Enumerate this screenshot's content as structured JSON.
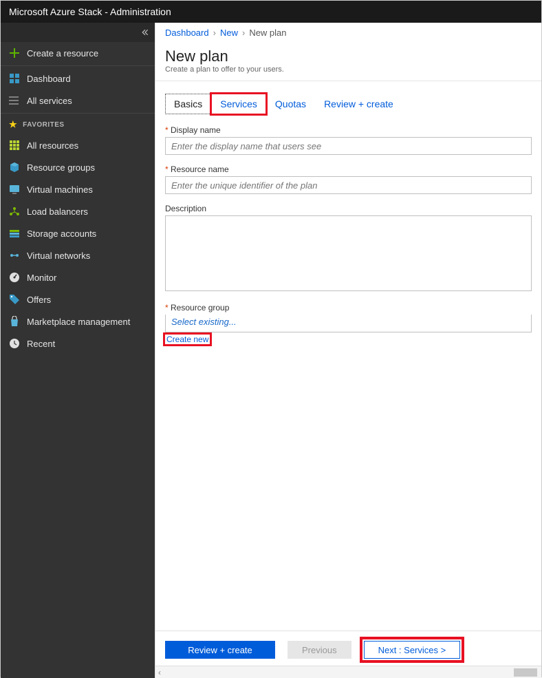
{
  "topbar": {
    "title": "Microsoft Azure Stack - Administration"
  },
  "sidebar": {
    "create": "Create a resource",
    "dashboard": "Dashboard",
    "all_services": "All services",
    "favorites_label": "FAVORITES",
    "items": [
      {
        "label": "All resources"
      },
      {
        "label": "Resource groups"
      },
      {
        "label": "Virtual machines"
      },
      {
        "label": "Load balancers"
      },
      {
        "label": "Storage accounts"
      },
      {
        "label": "Virtual networks"
      },
      {
        "label": "Monitor"
      },
      {
        "label": "Offers"
      },
      {
        "label": "Marketplace management"
      },
      {
        "label": "Recent"
      }
    ]
  },
  "breadcrumb": {
    "items": [
      "Dashboard",
      "New"
    ],
    "current": "New plan"
  },
  "page": {
    "title": "New plan",
    "subtitle": "Create a plan to offer to your users."
  },
  "tabs": {
    "basics": "Basics",
    "services": "Services",
    "quotas": "Quotas",
    "review": "Review + create"
  },
  "fields": {
    "display_name": {
      "label": "Display name",
      "placeholder": "Enter the display name that users see"
    },
    "resource_name": {
      "label": "Resource name",
      "placeholder": "Enter the unique identifier of the plan"
    },
    "description": {
      "label": "Description"
    },
    "resource_group": {
      "label": "Resource group",
      "placeholder": "Select existing...",
      "create_new": "Create new"
    }
  },
  "footer": {
    "review": "Review + create",
    "previous": "Previous",
    "next": "Next : Services >"
  },
  "colors": {
    "accent": "#015cda",
    "highlight": "#e81123",
    "sidebar_bg": "#333333"
  }
}
